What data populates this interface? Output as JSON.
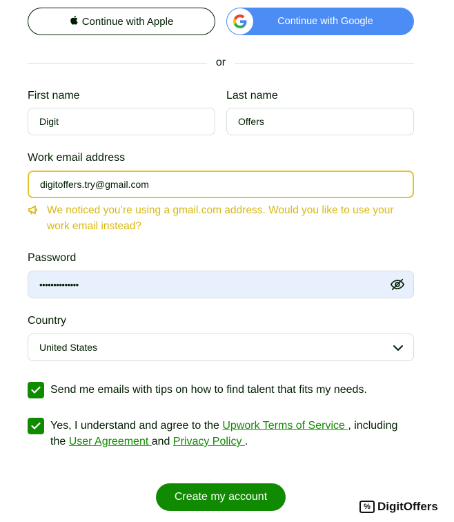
{
  "sso": {
    "apple_label": "Continue with Apple",
    "google_label": "Continue with Google"
  },
  "divider": {
    "or_text": "or"
  },
  "form": {
    "first_name": {
      "label": "First name",
      "value": "Digit"
    },
    "last_name": {
      "label": "Last name",
      "value": "Offers"
    },
    "email": {
      "label": "Work email address",
      "value": "digitoffers.try@gmail.com",
      "warning": "We noticed you’re using a gmail.com address. Would you like to use your work email instead?"
    },
    "password": {
      "label": "Password",
      "value": "••••••••••••••"
    },
    "country": {
      "label": "Country",
      "value": "United States"
    }
  },
  "checkboxes": {
    "tips": {
      "checked": true,
      "text": "Send me emails with tips on how to find talent that fits my needs."
    },
    "terms": {
      "checked": true,
      "text_before": "Yes, I understand and agree to the ",
      "link_tos": "Upwork Terms of Service ",
      "text_mid": ", including the ",
      "link_agreement": "User Agreement ",
      "text_and": "and ",
      "link_privacy": "Privacy Policy ",
      "text_end": "."
    }
  },
  "actions": {
    "create_label": "Create my account"
  },
  "watermark": {
    "text": "DigitOffers",
    "icon_glyph": "%"
  },
  "colors": {
    "brand_green": "#108a00",
    "google_blue": "#4b8cf5",
    "warning_yellow": "#d8b814",
    "autofill_bg": "#e8f0fe"
  },
  "icons": [
    "apple-icon",
    "google-icon",
    "megaphone-icon",
    "eye-off-icon",
    "chevron-down-icon",
    "check-icon"
  ]
}
